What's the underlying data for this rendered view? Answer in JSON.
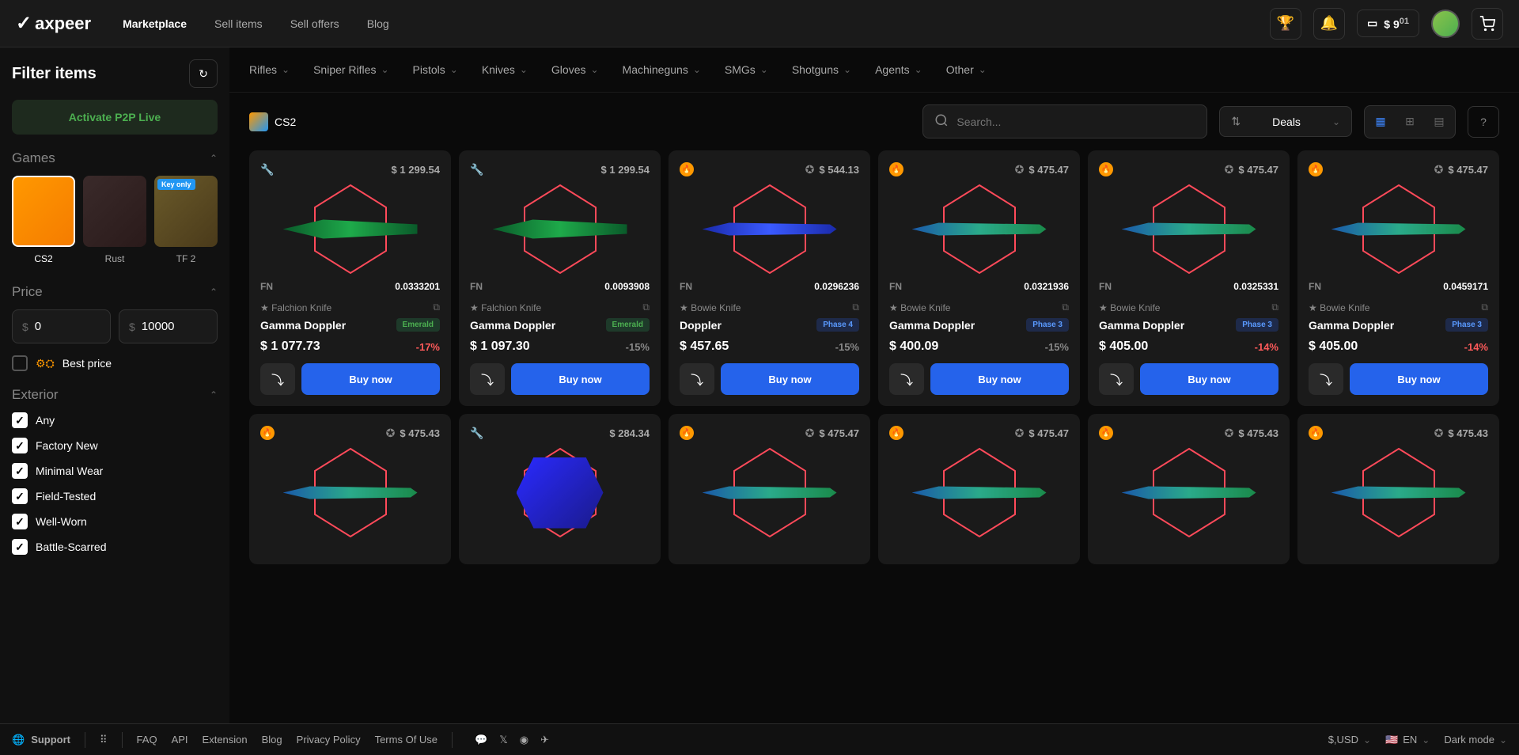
{
  "header": {
    "logo": "axpeer",
    "nav": [
      "Marketplace",
      "Sell items",
      "Sell offers",
      "Blog"
    ],
    "balance_currency": "$",
    "balance_whole": "9",
    "balance_cents": "01"
  },
  "sidebar": {
    "title": "Filter items",
    "activate_btn": "Activate P2P Live",
    "games_title": "Games",
    "games": [
      {
        "label": "CS2",
        "active": true
      },
      {
        "label": "Rust",
        "active": false
      },
      {
        "label": "TF 2",
        "active": false,
        "badge": "Key only"
      }
    ],
    "price_title": "Price",
    "price_min": "0",
    "price_max": "10000",
    "best_price": "Best price",
    "exterior_title": "Exterior",
    "exteriors": [
      "Any",
      "Factory New",
      "Minimal Wear",
      "Field-Tested",
      "Well-Worn",
      "Battle-Scarred"
    ]
  },
  "categories": [
    "Rifles",
    "Sniper Rifles",
    "Pistols",
    "Knives",
    "Gloves",
    "Machineguns",
    "SMGs",
    "Shotguns",
    "Agents",
    "Other"
  ],
  "toolbar": {
    "game_chip": "CS2",
    "search_placeholder": "Search...",
    "sort": "Deals"
  },
  "items": [
    {
      "top_icon": "steam",
      "top_price": "$ 1 299.54",
      "skin": "emerald",
      "wear": "FN",
      "float": "0.0333201",
      "type": "★ Falchion Knife",
      "name": "Gamma Doppler",
      "tag": "Emerald",
      "tag_type": "emerald",
      "price": "$ 1 077.73",
      "discount": "-17%",
      "disc_color": "green",
      "buy": "Buy now"
    },
    {
      "top_icon": "steam",
      "top_price": "$ 1 299.54",
      "skin": "emerald",
      "wear": "FN",
      "float": "0.0093908",
      "type": "★ Falchion Knife",
      "name": "Gamma Doppler",
      "tag": "Emerald",
      "tag_type": "emerald",
      "price": "$ 1 097.30",
      "discount": "-15%",
      "disc_color": "gray",
      "buy": "Buy now"
    },
    {
      "top_icon": "fire",
      "top_price": "$ 544.13",
      "skin": "blue",
      "wear": "FN",
      "float": "0.0296236",
      "type": "★ Bowie Knife",
      "name": "Doppler",
      "tag": "Phase 4",
      "tag_type": "phase",
      "price": "$ 457.65",
      "discount": "-15%",
      "disc_color": "gray",
      "buy": "Buy now"
    },
    {
      "top_icon": "fire",
      "top_price": "$ 475.47",
      "skin": "phase3",
      "wear": "FN",
      "float": "0.0321936",
      "type": "★ Bowie Knife",
      "name": "Gamma Doppler",
      "tag": "Phase 3",
      "tag_type": "phase",
      "price": "$ 400.09",
      "discount": "-15%",
      "disc_color": "gray",
      "buy": "Buy now"
    },
    {
      "top_icon": "fire",
      "top_price": "$ 475.47",
      "skin": "phase3",
      "wear": "FN",
      "float": "0.0325331",
      "type": "★ Bowie Knife",
      "name": "Gamma Doppler",
      "tag": "Phase 3",
      "tag_type": "phase",
      "price": "$ 405.00",
      "discount": "-14%",
      "disc_color": "green",
      "buy": "Buy now"
    },
    {
      "top_icon": "fire",
      "top_price": "$ 475.47",
      "skin": "phase3",
      "wear": "FN",
      "float": "0.0459171",
      "type": "★ Bowie Knife",
      "name": "Gamma Doppler",
      "tag": "Phase 3",
      "tag_type": "phase",
      "price": "$ 405.00",
      "discount": "-14%",
      "disc_color": "green",
      "buy": "Buy now"
    }
  ],
  "items_row2": [
    {
      "top_icon": "fire",
      "top_price": "$ 475.43",
      "skin": "phase3"
    },
    {
      "top_icon": "steam",
      "top_price": "$ 284.34",
      "skin": "shadow"
    },
    {
      "top_icon": "fire",
      "top_price": "$ 475.47",
      "skin": "phase3"
    },
    {
      "top_icon": "fire",
      "top_price": "$ 475.47",
      "skin": "phase3"
    },
    {
      "top_icon": "fire",
      "top_price": "$ 475.43",
      "skin": "phase3"
    },
    {
      "top_icon": "fire",
      "top_price": "$ 475.43",
      "skin": "phase3"
    }
  ],
  "footer": {
    "support": "Support",
    "links": [
      "FAQ",
      "API",
      "Extension",
      "Blog",
      "Privacy Policy",
      "Terms Of Use"
    ],
    "currency": "$,USD",
    "lang": "EN",
    "theme": "Dark mode"
  }
}
